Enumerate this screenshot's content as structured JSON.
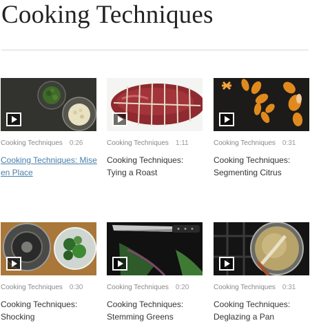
{
  "page": {
    "title": "Cooking Techniques"
  },
  "videos": [
    {
      "category": "Cooking Techniques",
      "duration": "0:26",
      "title": "Cooking Techniques: Mise en Place",
      "active": true,
      "thumbnail": "bowls-of-chopped-herbs-and-garlic"
    },
    {
      "category": "Cooking Techniques",
      "duration": "1:11",
      "title": "Cooking Techniques: Tying a Roast",
      "active": false,
      "thumbnail": "tied-beef-roast"
    },
    {
      "category": "Cooking Techniques",
      "duration": "0:31",
      "title": "Cooking Techniques: Segmenting Citrus",
      "active": false,
      "thumbnail": "orange-segments"
    },
    {
      "category": "Cooking Techniques",
      "duration": "0:30",
      "title": "Cooking Techniques: Shocking",
      "active": false,
      "thumbnail": "pot-and-ice-bath-with-greens"
    },
    {
      "category": "Cooking Techniques",
      "duration": "0:20",
      "title": "Cooking Techniques: Stemming Greens",
      "active": false,
      "thumbnail": "knife-and-leafy-greens"
    },
    {
      "category": "Cooking Techniques",
      "duration": "0:31",
      "title": "Cooking Techniques: Deglazing a Pan",
      "active": false,
      "thumbnail": "skillet-on-stove"
    }
  ],
  "colors": {
    "link_active": "#4a7ea8",
    "text": "#333333",
    "meta": "#888888",
    "divider": "#d6d6d6"
  },
  "icons": {
    "play": "play-icon"
  }
}
